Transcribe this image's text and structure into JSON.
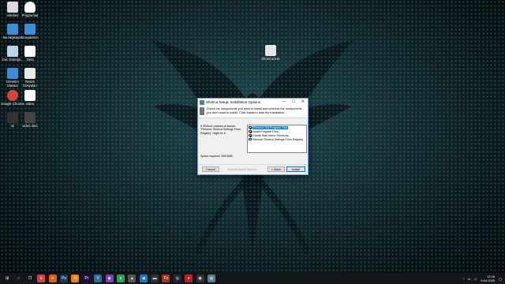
{
  "desktop": {
    "icons": [
      {
        "label": "estebes",
        "color": "#d9d9d9"
      },
      {
        "label": "Programlar",
        "color": "#ffffff"
      },
      {
        "label": "Bu bilgisayar",
        "color": "#3b8fd9"
      },
      {
        "label": "Dosyalarım",
        "color": "#3b8fd9"
      },
      {
        "label": "Geri Dönüşü...",
        "color": "#bcd4e6"
      },
      {
        "label": "Ders",
        "color": "#ffffff"
      },
      {
        "label": "Denetim Masası",
        "color": "#3b8fd9"
      },
      {
        "label": "Resim Dosyaları",
        "color": "#e8e8e8"
      },
      {
        "label": "Google Chrome",
        "color": "#d8443a"
      },
      {
        "label": "video",
        "color": "#ffffff"
      },
      {
        "label": "mi",
        "color": "#333333"
      },
      {
        "label": "video ders",
        "color": "#444444"
      }
    ],
    "file_icon": {
      "label": "Shortcut.exe"
    }
  },
  "dialog": {
    "title": "Shotcut Setup: Installation Options",
    "header_text": "Check the components you want to install and uncheck the components you don't want to install. Click Install to start the installation.",
    "description": "If Shotcut crashes at launch \"Remove Shotcut Settings From Registry\" might fix it.",
    "space_required": "Space required: 295.5MB",
    "components": [
      {
        "label": "Remove Old Program Files",
        "checked": true,
        "selected": true
      },
      {
        "label": "Install Program Files",
        "checked": true,
        "selected": false
      },
      {
        "label": "Create Start Menu Shortcuts",
        "checked": true,
        "selected": false
      },
      {
        "label": "Remove Shotcut Settings From Registry",
        "checked": false,
        "selected": false
      }
    ],
    "buttons": {
      "cancel": "Cancel",
      "brand": "Nullsoft Install System",
      "back": "< Back",
      "install": "Install"
    },
    "window_controls": {
      "minimize": "—",
      "maximize": "☐",
      "close": "✕"
    }
  },
  "taskbar": {
    "time": "12:16",
    "date": "9.04.2020",
    "apps": [
      {
        "name": "start",
        "color": "#ffffff",
        "glyph": "⊞"
      },
      {
        "name": "search",
        "color": "#ffffff",
        "glyph": "○"
      },
      {
        "name": "task-view",
        "color": "#ffffff",
        "glyph": "❐"
      },
      {
        "name": "chrome",
        "color": "#d8443a",
        "glyph": "●"
      },
      {
        "name": "firefox",
        "color": "#e66000",
        "glyph": "●"
      },
      {
        "name": "photoshop",
        "color": "#1b3b5e",
        "glyph": "Ps"
      },
      {
        "name": "illustrator",
        "color": "#ff7c00",
        "glyph": "Ai"
      },
      {
        "name": "premiere",
        "color": "#2a0a4a",
        "glyph": "Pr"
      },
      {
        "name": "vectorworks",
        "color": "#2a6e9e",
        "glyph": "V"
      },
      {
        "name": "visual-studio",
        "color": "#7d3fc0",
        "glyph": "◆"
      },
      {
        "name": "app-green",
        "color": "#2e9e5b",
        "glyph": "●"
      },
      {
        "name": "app-grey",
        "color": "#555555",
        "glyph": "▲"
      },
      {
        "name": "vscode",
        "color": "#1e74c6",
        "glyph": "◀"
      },
      {
        "name": "app-dark",
        "color": "#333333",
        "glyph": "▬"
      },
      {
        "name": "filezilla",
        "color": "#b03020",
        "glyph": "Fz"
      },
      {
        "name": "steam",
        "color": "#1b2838",
        "glyph": "◎"
      },
      {
        "name": "app-red",
        "color": "#c02020",
        "glyph": "●"
      },
      {
        "name": "obs",
        "color": "#333333",
        "glyph": "◉"
      },
      {
        "name": "shotcut-setup",
        "color": "#5a7b96",
        "glyph": "◍"
      }
    ]
  }
}
